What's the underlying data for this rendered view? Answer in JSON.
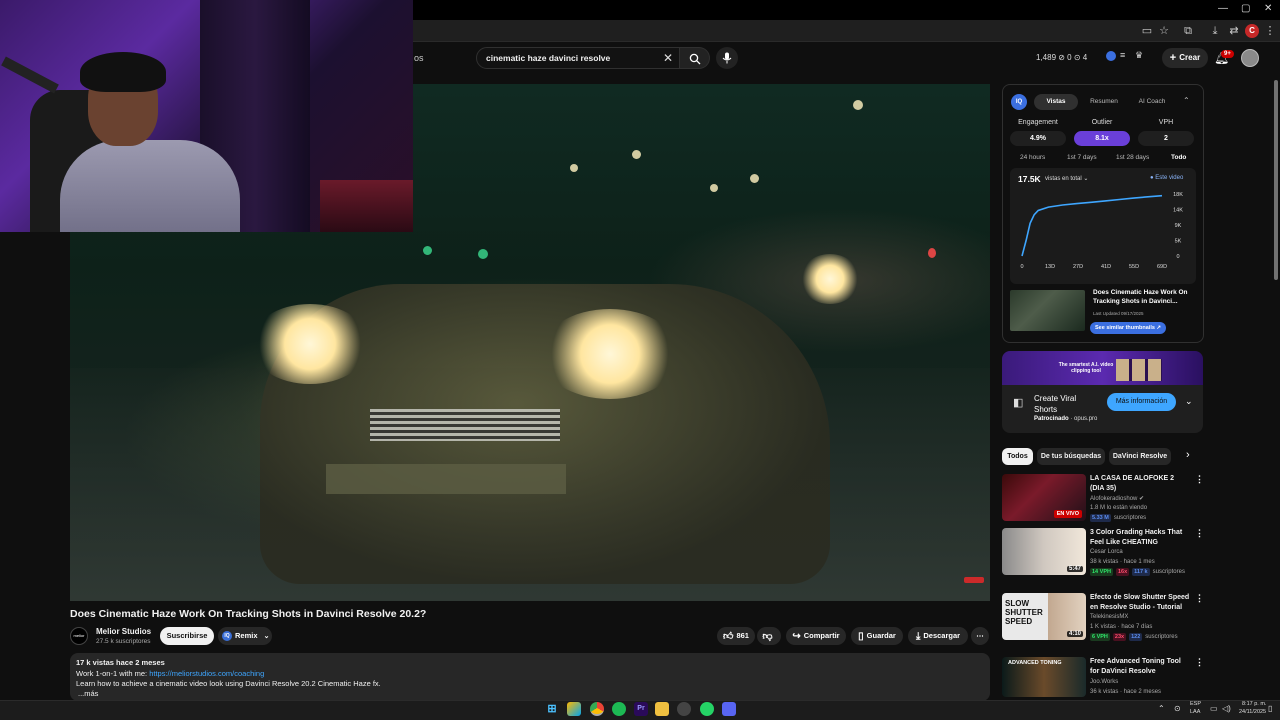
{
  "browser": {
    "window_controls": [
      "—",
      "▢",
      "✕"
    ]
  },
  "header": {
    "left_text": "os",
    "search_query": "cinematic haze davinci resolve",
    "ext_stats": "1,489 ⊘ 0 ⊙ 4",
    "create_label": "Crear",
    "notif_count": "9+"
  },
  "video": {
    "title": "Does Cinematic Haze Work On Tracking Shots in Davinci Resolve 20.2?",
    "channel_name": "Melior Studios",
    "channel_subs": "27.5 k suscriptores",
    "channel_logo_text": "melior",
    "subscribe_label": "Suscribirse",
    "remix_label": "Remix",
    "remix_icon_text": "IQ",
    "likes": "861",
    "share_label": "Compartir",
    "save_label": "Guardar",
    "download_label": "Descargar"
  },
  "description": {
    "views": "17 k vistas  hace 2 meses",
    "line1_prefix": "Work 1-on-1 with me: ",
    "line1_link": "https://meliorstudios.com/coaching",
    "line2": "Learn how to achieve a cinematic video look using Davinci Resolve 20.2 Cinematic Haze fx.",
    "more": "...más"
  },
  "ext_panel": {
    "logo": "IQ",
    "tabs": [
      "Vistas",
      "Resumen",
      "AI Coach"
    ],
    "metric_labels": [
      "Engagement",
      "Outlier",
      "VPH"
    ],
    "metric_values": [
      "4.9%",
      "8.1x",
      "2"
    ],
    "ranges": [
      "24 hours",
      "1st 7 days",
      "1st 28 days",
      "Todo"
    ],
    "total": "17.5K",
    "total_label": "vistas en total ⌄",
    "legend": "● Este video",
    "thumb_title": "Does Cinematic Haze Work On Tracking Shots in Davinci...",
    "thumb_updated": "Last Updated 09/17/2025",
    "see_similar": "See similar thumbnails ↗"
  },
  "chart_data": {
    "type": "line",
    "x_tick_labels": [
      "0",
      "13D",
      "27D",
      "41D",
      "55D",
      "69D"
    ],
    "y_tick_labels": [
      "18K",
      "14K",
      "9K",
      "5K",
      "0"
    ],
    "series": [
      {
        "x": [
          0,
          2,
          4,
          6,
          8,
          13,
          20,
          27,
          34,
          41,
          48,
          55,
          62,
          69
        ],
        "y": [
          0,
          4500,
          9500,
          12000,
          13200,
          14200,
          14800,
          15200,
          15600,
          16000,
          16400,
          16800,
          17200,
          17500
        ]
      }
    ],
    "xlim": [
      0,
      69
    ],
    "ylim": [
      0,
      18000
    ],
    "color": "#3ea6ff"
  },
  "ad": {
    "banner_text": "The smartest A.I. video clipping tool",
    "title": "Create Viral Shorts",
    "sponsored": "Patrocinado",
    "domain": "· opus.pro",
    "cta": "Más información"
  },
  "chips": [
    "Todos",
    "De tus búsquedas",
    "DaVinci Resolve"
  ],
  "recommendations": [
    {
      "title": "LA CASA DE ALOFOKE 2 (DIA 35)",
      "channel": "Alofokeradioshow ✔",
      "meta": "1.8 M lo están viendo",
      "subs": "5.33 M",
      "subs_suffix": "suscriptores",
      "live": "EN VIVO"
    },
    {
      "title": "3 Color Grading Hacks That Feel Like CHEATING",
      "channel": "Cesar Lorca",
      "meta": "38 k vistas · hace 1 mes",
      "vph": "14 VPH",
      "multiplier": "16x",
      "subs": "117 k",
      "subs_suffix": "suscriptores",
      "duration": "5:47"
    },
    {
      "title": "Efecto de Slow Shutter Speed en  Resolve Studio - Tutorial",
      "channel": "TelekinesisMX",
      "meta": "1 K vistas · hace 7 días",
      "vph": "6 VPH",
      "multiplier": "23x",
      "subs": "122",
      "subs_suffix": "suscriptores",
      "duration": "4:10",
      "thumb_text": "SLOW SHUTTER SPEED"
    },
    {
      "title": "Free Advanced Toning Tool for DaVinci Resolve",
      "channel": "Joo.Works",
      "meta": "36 k vistas · hace 2 meses",
      "thumb_text": "ADVANCED TONING"
    }
  ],
  "taskbar": {
    "lang_line1": "ESP",
    "lang_line2": "LAA",
    "time": "8:17 p. m.",
    "date": "24/11/2025"
  }
}
